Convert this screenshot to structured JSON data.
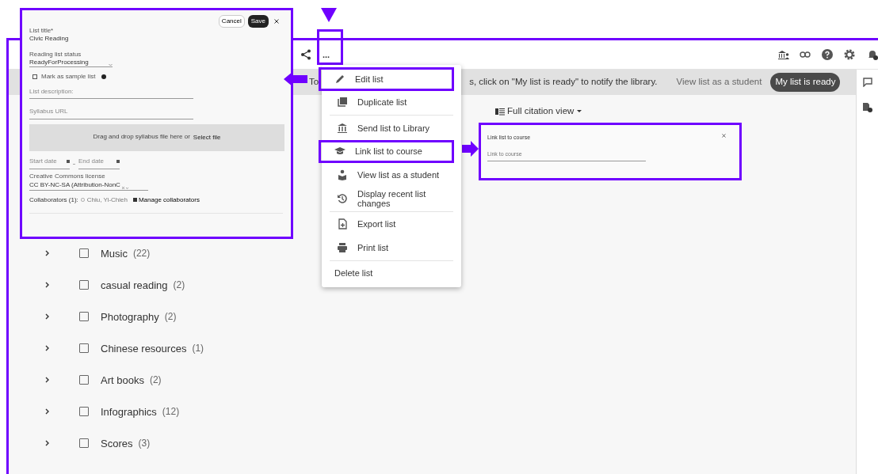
{
  "banner": {
    "text_start": "To",
    "text_end": "s, click on \"My list is ready\" to notify the library.",
    "link": "View list as a student",
    "button": "My list is ready"
  },
  "toolbar": {
    "more": "..."
  },
  "view_toggle": {
    "label": "Full citation view"
  },
  "sections": [
    {
      "name": "Music",
      "count": "(22)",
      "checked": false,
      "expanded": false
    },
    {
      "name": "casual reading",
      "count": "(2)",
      "checked": false,
      "expanded": false
    },
    {
      "name": "Photography",
      "count": "(2)",
      "checked": false,
      "expanded": false
    },
    {
      "name": "Chinese resources",
      "count": "(1)",
      "checked": false,
      "expanded": false
    },
    {
      "name": "Art books",
      "count": "(2)",
      "checked": false,
      "expanded": false
    },
    {
      "name": "Infographics",
      "count": "(12)",
      "checked": false,
      "expanded": false
    },
    {
      "name": "Scores",
      "count": "(3)",
      "checked": false,
      "expanded": false
    }
  ],
  "menu": {
    "groups": [
      [
        {
          "label": "Edit list",
          "highlighted": true
        },
        {
          "label": "Duplicate list",
          "highlighted": false
        }
      ],
      [
        {
          "label": "Send list to Library",
          "highlighted": false
        },
        {
          "label": "Link list to course",
          "highlighted": true
        },
        {
          "label": "View list as a student",
          "highlighted": false
        },
        {
          "label": "Display recent list changes",
          "highlighted": false
        }
      ],
      [
        {
          "label": "Export list",
          "highlighted": false
        },
        {
          "label": "Print list",
          "highlighted": false
        }
      ],
      [
        {
          "label": "Delete list",
          "highlighted": false
        }
      ]
    ]
  },
  "edit_panel": {
    "cancel": "Cancel",
    "save": "Save",
    "title_label": "List title*",
    "title_value": "Civic Reading",
    "status_label": "Reading list status",
    "status_value": "ReadyForProcessing",
    "sample_label": "Mark as sample list",
    "sample_checked": false,
    "description_placeholder": "List description:",
    "syllabus_placeholder": "Syllabus URL",
    "drop_text": "Drag and drop syllabus file here or",
    "drop_link": "Select file",
    "start_placeholder": "Start date",
    "end_placeholder": "End date",
    "license_label": "Creative Commons license",
    "license_value": "CC BY-NC-SA (Attribution-NonC",
    "collaborators_label": "Collaborators (1):",
    "collaborator": "Chiu, Yi-Chieh",
    "manage": "Manage collaborators"
  },
  "link_panel": {
    "title": "Link list to course",
    "placeholder": "Link to course"
  }
}
